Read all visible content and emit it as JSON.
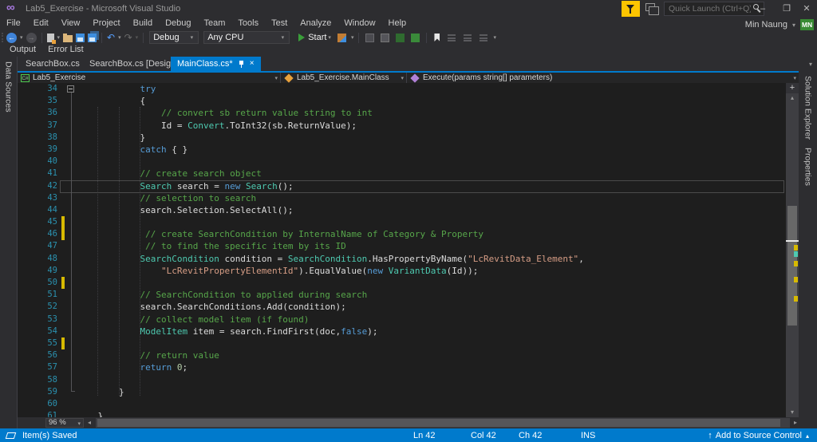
{
  "title_bar": {
    "title": "Lab5_Exercise - Microsoft Visual Studio",
    "quick_launch_placeholder": "Quick Launch (Ctrl+Q)",
    "user_name": "Min Naung",
    "user_initials": "MN",
    "minimize": "–",
    "restore": "❐",
    "close": "✕"
  },
  "menu": {
    "items": [
      "File",
      "Edit",
      "View",
      "Project",
      "Build",
      "Debug",
      "Team",
      "Tools",
      "Test",
      "Analyze",
      "Window",
      "Help"
    ]
  },
  "toolbar": {
    "config": "Debug",
    "platform": "Any CPU",
    "start_label": "Start"
  },
  "pane_tabs": {
    "output": "Output",
    "error_list": "Error List"
  },
  "doc_tabs": [
    {
      "label": "SearchBox.cs",
      "active": false
    },
    {
      "label": "SearchBox.cs [Design]",
      "active": false
    },
    {
      "label": "MainClass.cs*",
      "active": true
    }
  ],
  "side_strips": {
    "left": "Data Sources",
    "right_top": "Solution Explorer",
    "right_bottom": "Properties"
  },
  "nav_bar": {
    "project": "Lab5_Exercise",
    "type": "Lab5_Exercise.MainClass",
    "member": "Execute(params string[] parameters)",
    "csharp_badge": "C#"
  },
  "editor": {
    "zoom_level": "96 %",
    "lines": [
      {
        "n": 34,
        "fold": true,
        "segs": [
          [
            "p",
            "            "
          ],
          [
            "k",
            "try"
          ]
        ]
      },
      {
        "n": 35,
        "segs": [
          [
            "p",
            "            {"
          ]
        ]
      },
      {
        "n": 36,
        "segs": [
          [
            "p",
            "                "
          ],
          [
            "c",
            "// convert sb return value string to int"
          ]
        ]
      },
      {
        "n": 37,
        "segs": [
          [
            "p",
            "                Id = "
          ],
          [
            "t",
            "Convert"
          ],
          [
            "p",
            ".ToInt32(sb.ReturnValue);"
          ]
        ]
      },
      {
        "n": 38,
        "segs": [
          [
            "p",
            "            }"
          ]
        ]
      },
      {
        "n": 39,
        "segs": [
          [
            "p",
            "            "
          ],
          [
            "k",
            "catch"
          ],
          [
            "p",
            " { }"
          ]
        ]
      },
      {
        "n": 40,
        "segs": []
      },
      {
        "n": 41,
        "segs": [
          [
            "p",
            "            "
          ],
          [
            "c",
            "// create search object"
          ]
        ]
      },
      {
        "n": 42,
        "cur": true,
        "segs": [
          [
            "p",
            "            "
          ],
          [
            "t",
            "Search"
          ],
          [
            "p",
            " search = "
          ],
          [
            "k",
            "new"
          ],
          [
            "p",
            " "
          ],
          [
            "t",
            "Search"
          ],
          [
            "p",
            "();"
          ]
        ]
      },
      {
        "n": 43,
        "segs": [
          [
            "p",
            "            "
          ],
          [
            "c",
            "// selection to search"
          ]
        ]
      },
      {
        "n": 44,
        "segs": [
          [
            "p",
            "            search.Selection.SelectAll();"
          ]
        ]
      },
      {
        "n": 45,
        "chg": true,
        "segs": []
      },
      {
        "n": 46,
        "chg": true,
        "segs": [
          [
            "p",
            "             "
          ],
          [
            "c",
            "// create SearchCondition by InternalName of Category & Property"
          ]
        ]
      },
      {
        "n": 47,
        "segs": [
          [
            "p",
            "             "
          ],
          [
            "c",
            "// to find the specific item by its ID"
          ]
        ]
      },
      {
        "n": 48,
        "segs": [
          [
            "p",
            "            "
          ],
          [
            "t",
            "SearchCondition"
          ],
          [
            "p",
            " condition = "
          ],
          [
            "t",
            "SearchCondition"
          ],
          [
            "p",
            ".HasPropertyByName("
          ],
          [
            "s",
            "\"LcRevitData_Element\""
          ],
          [
            "p",
            ","
          ]
        ]
      },
      {
        "n": 49,
        "segs": [
          [
            "p",
            "                "
          ],
          [
            "s",
            "\"LcRevitPropertyElementId\""
          ],
          [
            "p",
            ").EqualValue("
          ],
          [
            "k",
            "new"
          ],
          [
            "p",
            " "
          ],
          [
            "t",
            "VariantData"
          ],
          [
            "p",
            "(Id));"
          ]
        ]
      },
      {
        "n": 50,
        "chg": true,
        "segs": []
      },
      {
        "n": 51,
        "segs": [
          [
            "p",
            "            "
          ],
          [
            "c",
            "// SearchCondition to applied during search"
          ]
        ]
      },
      {
        "n": 52,
        "segs": [
          [
            "p",
            "            search.SearchConditions.Add(condition);"
          ]
        ]
      },
      {
        "n": 53,
        "segs": [
          [
            "p",
            "            "
          ],
          [
            "c",
            "// collect model item (if found)"
          ]
        ]
      },
      {
        "n": 54,
        "segs": [
          [
            "p",
            "            "
          ],
          [
            "t",
            "ModelItem"
          ],
          [
            "p",
            " item = search.FindFirst(doc,"
          ],
          [
            "k",
            "false"
          ],
          [
            "p",
            ");"
          ]
        ]
      },
      {
        "n": 55,
        "chg": true,
        "segs": []
      },
      {
        "n": 56,
        "segs": [
          [
            "p",
            "            "
          ],
          [
            "c",
            "// return value"
          ]
        ]
      },
      {
        "n": 57,
        "segs": [
          [
            "p",
            "            "
          ],
          [
            "k",
            "return"
          ],
          [
            "p",
            " "
          ],
          [
            "n2",
            "0"
          ],
          [
            "p",
            ";"
          ]
        ]
      },
      {
        "n": 58,
        "segs": []
      },
      {
        "n": 59,
        "segs": [
          [
            "p",
            "        }"
          ]
        ]
      },
      {
        "n": 60,
        "segs": []
      },
      {
        "n": 61,
        "segs": [
          [
            "p",
            "    }"
          ]
        ]
      }
    ]
  },
  "status_bar": {
    "message": "Item(s) Saved",
    "line": "Ln 42",
    "column": "Col 42",
    "character": "Ch 42",
    "mode": "INS",
    "source_control": "Add to Source Control"
  },
  "colors": {
    "accent": "#007ACC",
    "keyword": "#569CD6",
    "type": "#4EC9B0",
    "string": "#D69D85",
    "comment": "#57A64A",
    "number": "#B5CEA8",
    "plain": "#DCDCDC",
    "line_number": "#2B91AF",
    "change_bar": "#D7BA00",
    "user_badge": "#388A34",
    "filter_bg": "#FDC500",
    "editor_bg": "#1E1E1E"
  }
}
